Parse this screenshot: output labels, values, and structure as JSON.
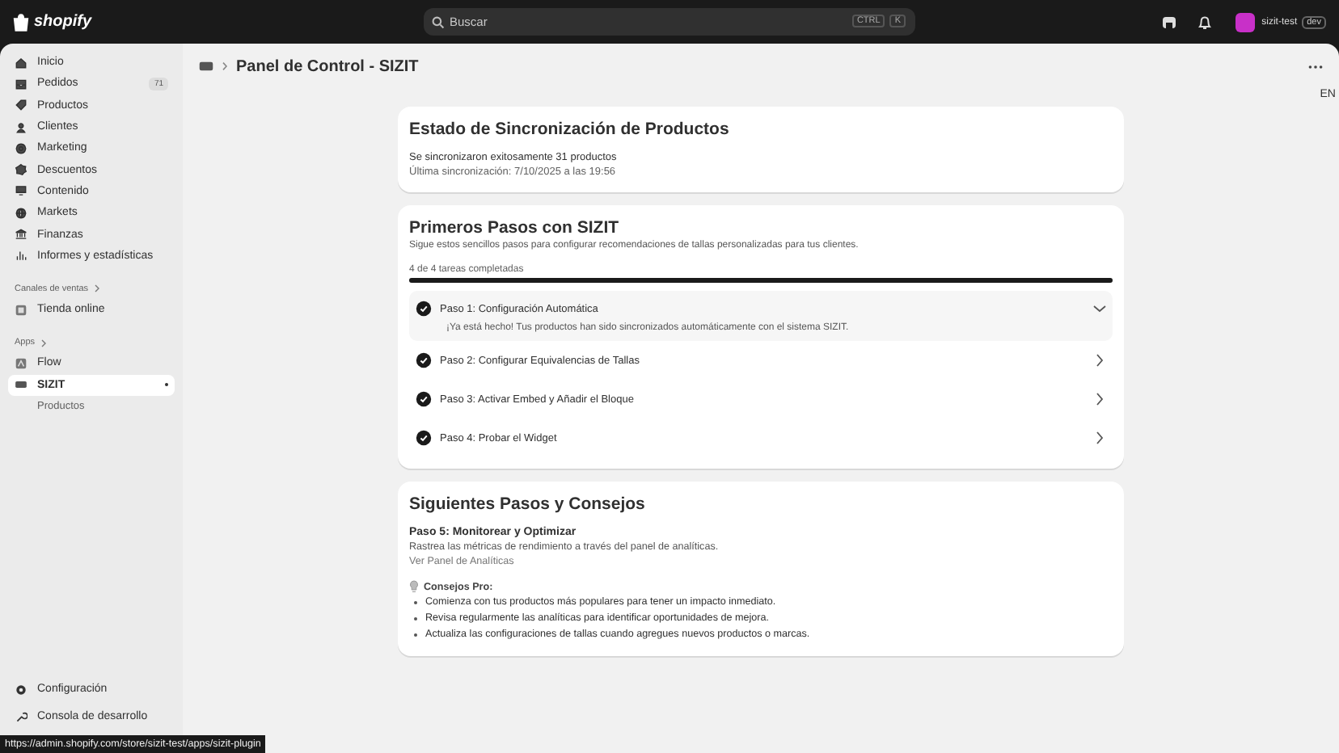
{
  "topbar": {
    "logo": "shopify",
    "search": {
      "placeholder": "Buscar",
      "shortcut": [
        "CTRL",
        "K"
      ]
    },
    "store": {
      "name": "sizit-test",
      "badge": "dev"
    }
  },
  "sidebar": {
    "items": [
      {
        "label": "Inicio",
        "selected": false
      },
      {
        "label": "Pedidos",
        "count": "71",
        "selected": false
      },
      {
        "label": "Productos",
        "selected": false
      },
      {
        "label": "Clientes",
        "selected": false
      },
      {
        "label": "Marketing",
        "selected": false
      },
      {
        "label": "Descuentos",
        "selected": false
      },
      {
        "label": "Contenido",
        "selected": false
      },
      {
        "label": "Markets",
        "selected": false
      },
      {
        "label": "Finanzas",
        "selected": false
      },
      {
        "label": "Informes y estadísticas",
        "selected": false
      }
    ],
    "sales_channels": {
      "heading": "Canales de ventas",
      "items": [
        {
          "label": "Tienda online",
          "selected": false
        }
      ]
    },
    "apps": {
      "heading": "Apps",
      "items": [
        {
          "label": "Flow",
          "selected": false
        },
        {
          "label": "SIZIT",
          "selected": true,
          "children": [
            {
              "label": "Productos",
              "selected": false
            }
          ]
        }
      ]
    },
    "bottom_items": [
      {
        "label": "Configuración"
      },
      {
        "label": "Consola de desarrollo"
      }
    ]
  },
  "page": {
    "title": "Panel de Control - SIZIT",
    "language": "EN"
  },
  "sync_card": {
    "title": "Estado de Sincronización de Productos",
    "lines": [
      "Se sincronizaron exitosamente 31 productos",
      "Última sincronización: 7/10/2025 a las 19:56"
    ]
  },
  "setup_card": {
    "title": "Primeros Pasos con SIZIT",
    "subtitle": "Sigue estos sencillos pasos para configurar recomendaciones de tallas personalizadas para tus clientes.",
    "progress_label": "4 de 4 tareas completadas",
    "progress": {
      "level": 1.0
    },
    "steps": [
      {
        "label": "Paso 1: Configuración Automática",
        "done": true,
        "expanded": true,
        "description": "¡Ya está hecho! Tus productos han sido sincronizados automáticamente con el sistema SIZIT."
      },
      {
        "label": "Paso 2: Configurar Equivalencias de Tallas",
        "done": true,
        "expanded": false
      },
      {
        "label": "Paso 3: Activar Embed y Añadir el Bloque",
        "done": true,
        "expanded": false
      },
      {
        "label": "Paso 4: Probar el Widget",
        "done": true,
        "expanded": false
      }
    ]
  },
  "tips_card": {
    "title": "Siguientes Pasos y Consejos",
    "step_title": "Paso 5: Monitorear y Optimizar",
    "step_text": "Rastrea las métricas de rendimiento a través del panel de analíticas.",
    "link": "Ver Panel de Analíticas",
    "tips_heading": "Consejos Pro:",
    "tips": [
      "Comienza con tus productos más populares para tener un impacto inmediato.",
      "Revisa regularmente las analíticas para identificar oportunidades de mejora.",
      "Actualiza las configuraciones de tallas cuando agregues nuevos productos o marcas."
    ]
  },
  "status_bar": {
    "url": "https://admin.shopify.com/store/sizit-test/apps/sizit-plugin"
  }
}
